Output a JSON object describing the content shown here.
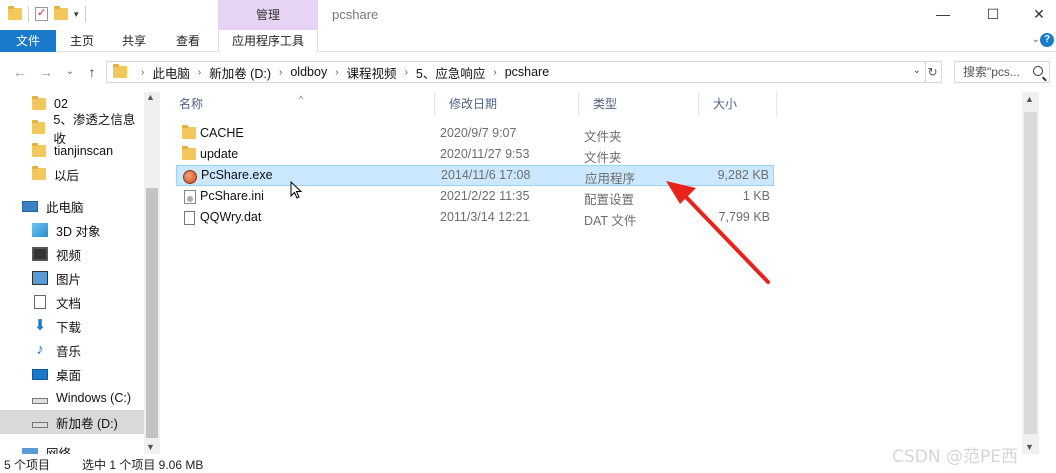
{
  "window": {
    "title": "pcshare",
    "manage_tab": "管理",
    "minimize": "—",
    "maximize": "☐",
    "close": "✕"
  },
  "ribbon": {
    "tabs": [
      "文件",
      "主页",
      "共享",
      "查看",
      "应用程序工具"
    ],
    "expand": "⌄",
    "help": "?"
  },
  "address": {
    "crumbs": [
      "此电脑",
      "新加卷 (D:)",
      "oldboy",
      "课程视频",
      "5、应急响应",
      "pcshare"
    ],
    "search_placeholder": "搜索\"pcs...",
    "back": "←",
    "forward": "→",
    "recent": "⌄",
    "up": "↑",
    "refresh": "↻"
  },
  "sidebar": {
    "folders": [
      "02",
      "5、渗透之信息收",
      "tianjinscan",
      "以后"
    ],
    "this_pc": "此电脑",
    "items": [
      "3D 对象",
      "视频",
      "图片",
      "文档",
      "下载",
      "音乐",
      "桌面",
      "Windows (C:)",
      "新加卷 (D:)",
      "网络"
    ]
  },
  "columns": {
    "name": "名称",
    "date": "修改日期",
    "type": "类型",
    "size": "大小"
  },
  "files": [
    {
      "name": "CACHE",
      "date": "2020/9/7 9:07",
      "type": "文件夹",
      "size": ""
    },
    {
      "name": "update",
      "date": "2020/11/27 9:53",
      "type": "文件夹",
      "size": ""
    },
    {
      "name": "PcShare.exe",
      "date": "2014/11/6 17:08",
      "type": "应用程序",
      "size": "9,282 KB"
    },
    {
      "name": "PcShare.ini",
      "date": "2021/2/22 11:35",
      "type": "配置设置",
      "size": "1 KB"
    },
    {
      "name": "QQWry.dat",
      "date": "2011/3/14 12:21",
      "type": "DAT 文件",
      "size": "7,799 KB"
    }
  ],
  "status": {
    "count": "5 个项目",
    "selection": "选中 1 个项目  9.06 MB"
  },
  "watermark": "CSDN @范PE西",
  "colors": {
    "accent": "#1979ca",
    "manage_tab": "#e7d3f4",
    "selected_row": "#cce8ff",
    "arrow": "#e8231b"
  }
}
